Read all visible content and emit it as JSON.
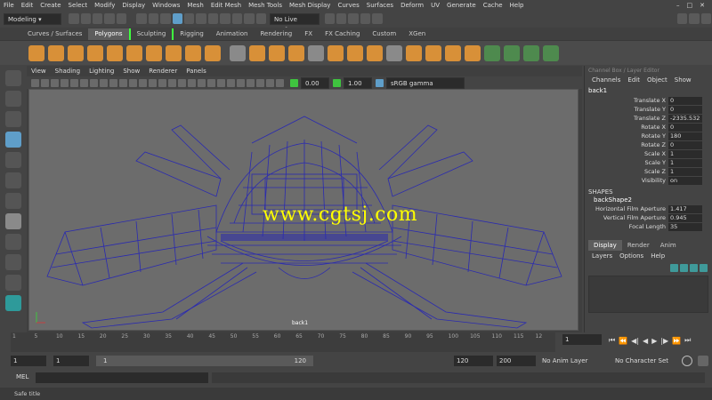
{
  "menubar": {
    "items": [
      "File",
      "Edit",
      "Create",
      "Select",
      "Modify",
      "Display",
      "Windows",
      "Mesh",
      "Edit Mesh",
      "Mesh Tools",
      "Mesh Display",
      "Curves",
      "Surfaces",
      "Deform",
      "UV",
      "Generate",
      "Cache",
      "Help"
    ]
  },
  "statusline": {
    "menuset": "Modeling",
    "live_surface": "No Live Surface"
  },
  "shelf": {
    "tabs": [
      "Curves / Surfaces",
      "Polygons",
      "Sculpting",
      "Rigging",
      "Animation",
      "Rendering",
      "FX",
      "FX Caching",
      "Custom",
      "XGen"
    ],
    "active_tab": "Polygons"
  },
  "panel": {
    "menu": [
      "View",
      "Shading",
      "Lighting",
      "Show",
      "Renderer",
      "Panels"
    ],
    "field1": "0.00",
    "field2": "1.00",
    "color_space": "sRGB gamma",
    "camera_label": "back1",
    "watermark": "www.cgtsj.com"
  },
  "channelbox": {
    "title": "Channel Box / Layer Editor",
    "menu": [
      "Channels",
      "Edit",
      "Object",
      "Show"
    ],
    "object": "back1",
    "attributes": [
      {
        "label": "Translate X",
        "value": "0"
      },
      {
        "label": "Translate Y",
        "value": "0"
      },
      {
        "label": "Translate Z",
        "value": "-2335.532"
      },
      {
        "label": "Rotate X",
        "value": "0"
      },
      {
        "label": "Rotate Y",
        "value": "180"
      },
      {
        "label": "Rotate Z",
        "value": "0"
      },
      {
        "label": "Scale X",
        "value": "1"
      },
      {
        "label": "Scale Y",
        "value": "1"
      },
      {
        "label": "Scale Z",
        "value": "1"
      },
      {
        "label": "Visibility",
        "value": "on"
      }
    ],
    "shapes_header": "SHAPES",
    "shape_name": "backShape2",
    "shape_attributes": [
      {
        "label": "Horizontal Film Aperture",
        "value": "1.417"
      },
      {
        "label": "Vertical Film Aperture",
        "value": "0.945"
      },
      {
        "label": "Focal Length",
        "value": "35"
      }
    ],
    "layer_tabs": [
      "Display",
      "Render",
      "Anim"
    ],
    "layer_menu": [
      "Layers",
      "Options",
      "Help"
    ]
  },
  "timeslider": {
    "tick_labels": [
      "1",
      "5",
      "10",
      "15",
      "20",
      "25",
      "30",
      "35",
      "40",
      "45",
      "50",
      "55",
      "60",
      "65",
      "70",
      "75",
      "80",
      "85",
      "90",
      "95",
      "100",
      "105",
      "110",
      "115",
      "12"
    ],
    "current_frame": "1"
  },
  "rangebar": {
    "start": "1",
    "playback_start": "1",
    "range_left": "1",
    "range_right": "120",
    "playback_end": "120",
    "end": "200",
    "anim_layer": "No Anim Layer",
    "character_set": "No Character Set"
  },
  "melbar": {
    "label": "MEL"
  },
  "helpline": {
    "text": "Safe title"
  }
}
